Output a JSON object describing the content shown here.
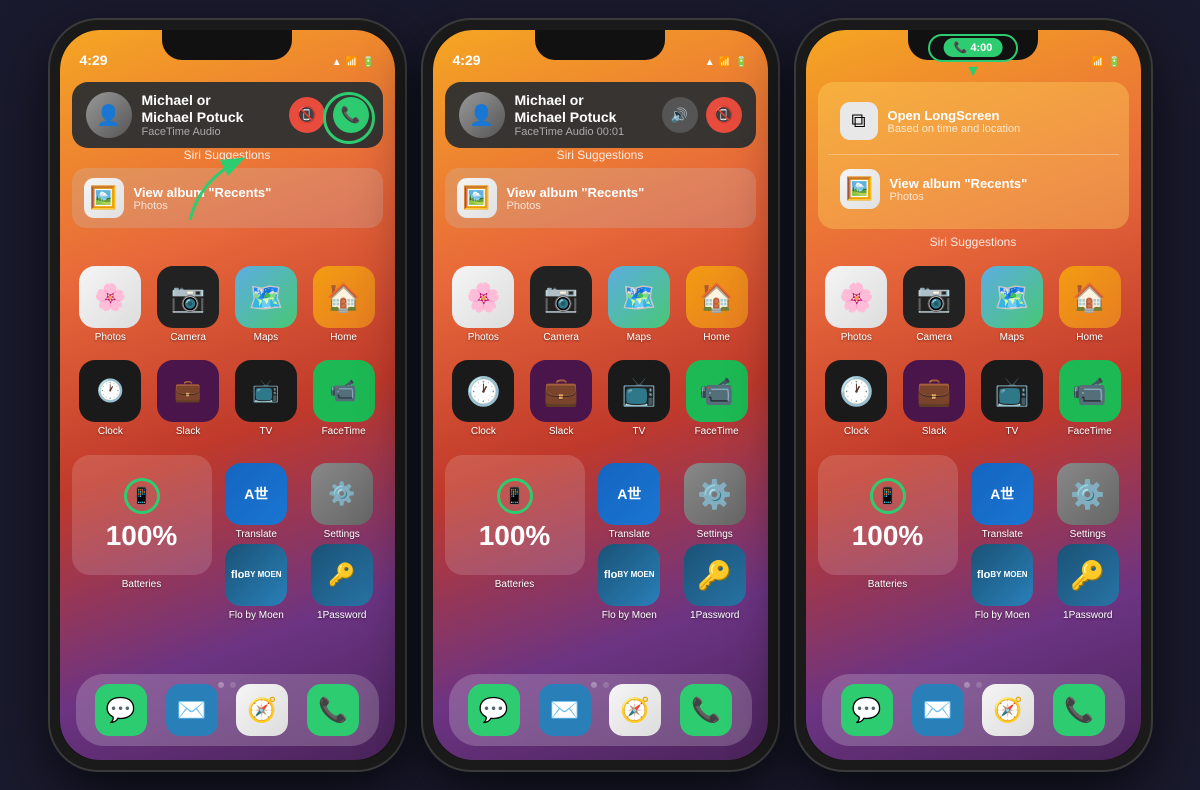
{
  "phones": [
    {
      "id": "phone1",
      "time": "4:29",
      "call": {
        "name": "Michael or\nMichael Potuck",
        "type": "FaceTime Audio",
        "has_accept": true,
        "has_decline": true,
        "has_mute": false,
        "active": false
      },
      "show_green_ring": true,
      "show_arrow": true,
      "suggestions": [
        {
          "icon": "🖼️",
          "title": "View album \"Recents\"",
          "sub": "Photos"
        }
      ],
      "apps_row1": [
        {
          "icon": "🌸",
          "label": "Photos",
          "bg": "photos"
        },
        {
          "icon": "📷",
          "label": "Camera",
          "bg": "camera"
        },
        {
          "icon": "🗺️",
          "label": "Maps",
          "bg": "maps"
        },
        {
          "icon": "🏠",
          "label": "Home",
          "bg": "home"
        }
      ],
      "apps_row2": [
        {
          "icon": "🕐",
          "label": "Clock",
          "bg": "clock"
        },
        {
          "icon": "#",
          "label": "Slack",
          "bg": "slack"
        },
        {
          "icon": "📺",
          "label": "TV",
          "bg": "tv"
        },
        {
          "icon": "🎥",
          "label": "FaceTime",
          "bg": "facetime"
        }
      ],
      "battery_pct": "100%",
      "apps_row3_right": [
        {
          "icon": "Aa",
          "label": "Translate",
          "bg": "translate"
        },
        {
          "icon": "⚙️",
          "label": "Settings",
          "bg": "settings"
        }
      ],
      "apps_row4": [
        {
          "icon": "flo",
          "label": "Flo by Moen",
          "bg": "flo"
        },
        {
          "icon": "🔑",
          "label": "1Password",
          "bg": "1password"
        }
      ],
      "dock": [
        "💬",
        "✉️",
        "🧭",
        "📞"
      ]
    },
    {
      "id": "phone2",
      "time": "4:29",
      "call": {
        "name": "Michael or\nMichael Potuck",
        "type": "FaceTime Audio 00:01",
        "has_accept": false,
        "has_decline": true,
        "has_mute": true,
        "active": true
      },
      "show_green_ring": false,
      "show_arrow": false,
      "suggestions": [
        {
          "icon": "🖼️",
          "title": "View album \"Recents\"",
          "sub": "Photos"
        }
      ]
    },
    {
      "id": "phone3",
      "time": "4:00",
      "show_pill": true,
      "pill_text": "4:00",
      "show_pill_ring": true,
      "show_arrow_down": true,
      "suggestions_light": [
        {
          "icon": "⧉",
          "title": "Open LongScreen",
          "sub": "Based on time and location"
        },
        {
          "icon": "🖼️",
          "title": "View album \"Recents\"",
          "sub": "Photos"
        }
      ]
    }
  ],
  "app_icons": {
    "Photos": "🌸",
    "Camera": "📷",
    "Maps": "🗺️",
    "Home": "🏠",
    "Clock": "🕐",
    "Slack": "💬",
    "TV": "📺",
    "FaceTime": "📹",
    "Translate": "Aa",
    "Settings": "⚙️",
    "Batteries": "🔋",
    "Flo by Moen": "💧",
    "1Password": "🔑",
    "Messages": "💬",
    "Mail": "✉️",
    "Safari": "🧭",
    "Phone": "📞"
  },
  "siri_label": "Siri Suggestions",
  "labels": {
    "photos": "Photos",
    "camera": "Camera",
    "maps": "Maps",
    "home": "Home",
    "clock": "Clock",
    "slack": "Slack",
    "tv": "TV",
    "facetime": "FaceTime",
    "translate": "Translate",
    "settings": "Settings",
    "batteries": "Batteries",
    "flo": "Flo by Moen",
    "onepassword": "1Password",
    "view_album": "View album \"Recents\"",
    "photos_app": "Photos",
    "open_longscreen": "Open LongScreen",
    "based_on_location": "Based on time and location"
  }
}
